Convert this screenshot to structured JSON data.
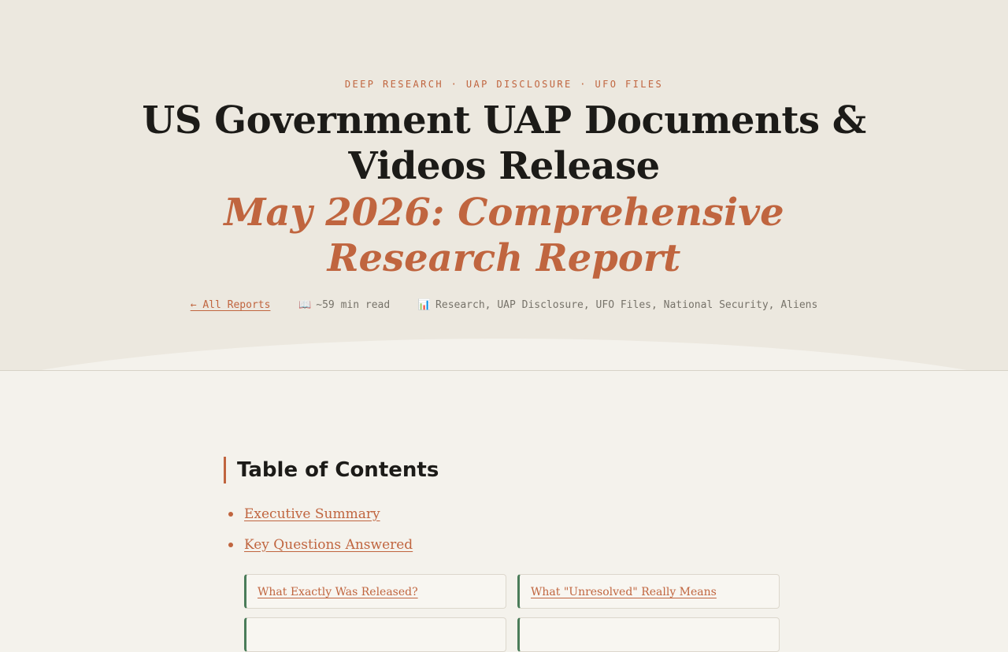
{
  "hero": {
    "eyebrow": "DEEP RESEARCH · UAP DISCLOSURE · UFO FILES",
    "title": "US Government UAP Documents & Videos Release",
    "subtitle": "May 2026: Comprehensive Research Report",
    "meta": {
      "back_link": "← All Reports",
      "read_icon": "📖",
      "read_time": "~59 min read",
      "tags_icon": "📊",
      "tags": "Research, UAP Disclosure, UFO Files, National Security, Aliens"
    }
  },
  "toc": {
    "heading": "Table of Contents",
    "items": [
      {
        "label": "Executive Summary"
      },
      {
        "label": "Key Questions Answered"
      }
    ],
    "cards": [
      {
        "label": "What Exactly Was Released?"
      },
      {
        "label": "What \"Unresolved\" Really Means"
      },
      {
        "label": ""
      },
      {
        "label": ""
      }
    ]
  },
  "colors": {
    "accent": "#c0653f",
    "card_border_accent": "#4a7c59",
    "hero_bg": "#ece8df",
    "page_bg": "#f4f2ec"
  }
}
